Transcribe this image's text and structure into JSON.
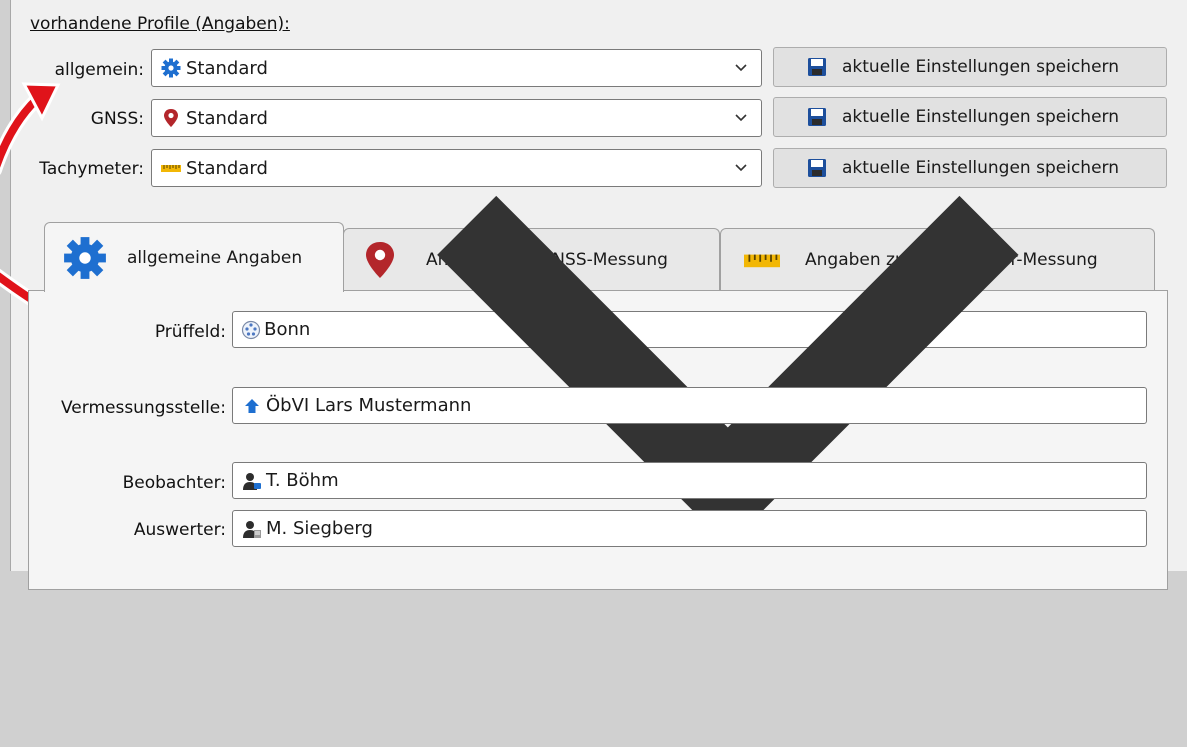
{
  "profiles": {
    "title": "vorhandene Profile (Angaben):",
    "rows": [
      {
        "label": "allgemein:",
        "value": "Standard",
        "icon": "gear-icon",
        "save_label": "aktuelle Einstellungen speichern"
      },
      {
        "label": "GNSS:",
        "value": "Standard",
        "icon": "map-pin-icon",
        "save_label": "aktuelle Einstellungen speichern"
      },
      {
        "label": "Tachymeter:",
        "value": "Standard",
        "icon": "ruler-icon",
        "save_label": "aktuelle Einstellungen speichern"
      }
    ]
  },
  "tabs": [
    {
      "label": "allgemeine Angaben",
      "icon": "gear-icon",
      "active": true
    },
    {
      "label": "Angaben zur GNSS-Messung",
      "icon": "map-pin-icon",
      "active": false
    },
    {
      "label": "Angaben zur Tachymeter-Messung",
      "icon": "ruler-icon",
      "active": false
    }
  ],
  "general": {
    "prueffeld": {
      "label": "Prüffeld:",
      "value": "Bonn",
      "icon": "test-field-icon"
    },
    "vermessungsstelle": {
      "label": "Vermessungsstelle:",
      "value": "ÖbVI Lars Mustermann",
      "icon": "home-arrow-icon"
    },
    "beobachter": {
      "label": "Beobachter:",
      "value": "T. Böhm",
      "icon": "observer-person-icon"
    },
    "auswerter": {
      "label": "Auswerter:",
      "value": "M. Siegberg",
      "icon": "analyst-person-icon"
    }
  },
  "colors": {
    "accent_blue": "#1e6fd0",
    "pin_red": "#b3262b",
    "ruler_yellow": "#f2b705",
    "annotation_red": "#e0131a"
  }
}
